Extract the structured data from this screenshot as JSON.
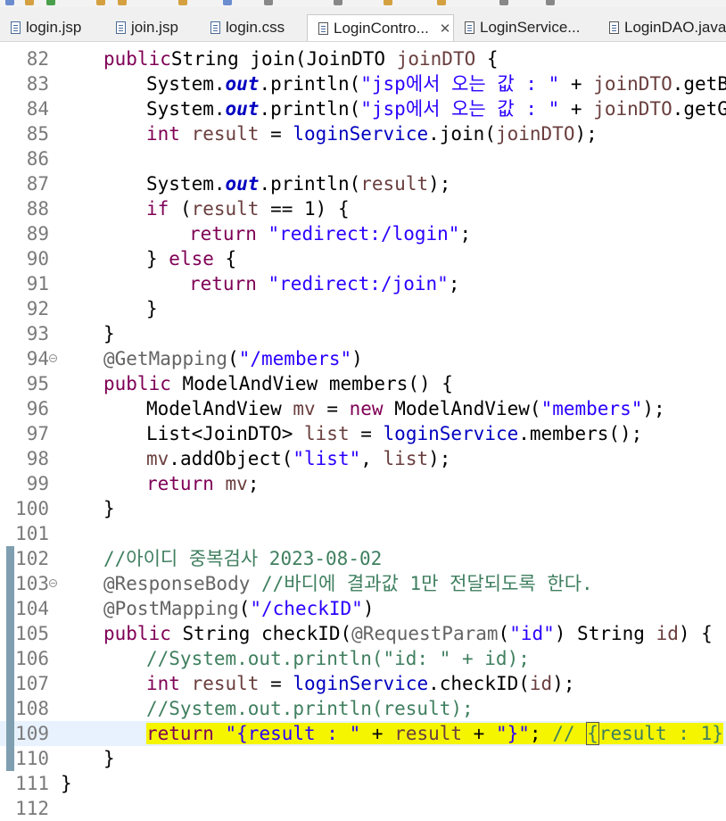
{
  "tabs": [
    {
      "label": "login.jsp",
      "icon": "jsp-file-icon",
      "active": false
    },
    {
      "label": "join.jsp",
      "icon": "jsp-file-icon",
      "active": false
    },
    {
      "label": "login.css",
      "icon": "css-file-icon",
      "active": false
    },
    {
      "label": "LoginContro...",
      "icon": "java-file-icon",
      "active": true,
      "close": "✕"
    },
    {
      "label": "LoginService...",
      "icon": "java-file-icon",
      "active": false
    },
    {
      "label": "LoginDAO.java",
      "icon": "java-file-icon",
      "active": false
    }
  ],
  "editor": {
    "current_line": 109,
    "lines": [
      {
        "n": "82",
        "indent": 1,
        "tokens": [
          [
            "kw",
            "public"
          ],
          [
            "",
            "String join(JoinDTO "
          ],
          [
            "var",
            "joinDTO"
          ],
          [
            "",
            " {"
          ]
        ]
      },
      {
        "n": "83",
        "indent": 2,
        "tokens": [
          [
            "",
            "System."
          ],
          [
            "sfld",
            "out"
          ],
          [
            "",
            ".println("
          ],
          [
            "str",
            "\"jsp에서 오는 값 : \""
          ],
          [
            "",
            " + "
          ],
          [
            "var",
            "joinDTO"
          ],
          [
            "",
            ".getBi"
          ]
        ]
      },
      {
        "n": "84",
        "indent": 2,
        "tokens": [
          [
            "",
            "System."
          ],
          [
            "sfld",
            "out"
          ],
          [
            "",
            ".println("
          ],
          [
            "str",
            "\"jsp에서 오는 값 : \""
          ],
          [
            "",
            " + "
          ],
          [
            "var",
            "joinDTO"
          ],
          [
            "",
            ".getGe"
          ]
        ]
      },
      {
        "n": "85",
        "indent": 2,
        "tokens": [
          [
            "kw",
            "int"
          ],
          [
            "",
            " "
          ],
          [
            "var",
            "result"
          ],
          [
            "",
            " = "
          ],
          [
            "fld",
            "loginService"
          ],
          [
            "",
            ".join("
          ],
          [
            "var",
            "joinDTO"
          ],
          [
            "",
            ");"
          ]
        ]
      },
      {
        "n": "86",
        "indent": 2,
        "tokens": []
      },
      {
        "n": "87",
        "indent": 2,
        "tokens": [
          [
            "",
            "System."
          ],
          [
            "sfld",
            "out"
          ],
          [
            "",
            ".println("
          ],
          [
            "var",
            "result"
          ],
          [
            "",
            ");"
          ]
        ]
      },
      {
        "n": "88",
        "indent": 2,
        "tokens": [
          [
            "kw",
            "if"
          ],
          [
            "",
            " ("
          ],
          [
            "var",
            "result"
          ],
          [
            "",
            " == 1) {"
          ]
        ]
      },
      {
        "n": "89",
        "indent": 3,
        "tokens": [
          [
            "kw",
            "return"
          ],
          [
            "",
            " "
          ],
          [
            "str",
            "\"redirect:/login\""
          ],
          [
            "",
            ";"
          ]
        ]
      },
      {
        "n": "90",
        "indent": 2,
        "tokens": [
          [
            "",
            "} "
          ],
          [
            "kw",
            "else"
          ],
          [
            "",
            " {"
          ]
        ]
      },
      {
        "n": "91",
        "indent": 3,
        "tokens": [
          [
            "kw",
            "return"
          ],
          [
            "",
            " "
          ],
          [
            "str",
            "\"redirect:/join\""
          ],
          [
            "",
            ";"
          ]
        ]
      },
      {
        "n": "92",
        "indent": 2,
        "tokens": [
          [
            "",
            "}"
          ]
        ]
      },
      {
        "n": "93",
        "indent": 1,
        "tokens": [
          [
            "",
            "}"
          ]
        ]
      },
      {
        "n": "94",
        "indent": 1,
        "fold": true,
        "tokens": [
          [
            "ann",
            "@GetMapping"
          ],
          [
            "",
            "("
          ],
          [
            "str",
            "\"/members\""
          ],
          [
            "",
            ")"
          ]
        ]
      },
      {
        "n": "95",
        "indent": 1,
        "tokens": [
          [
            "kw",
            "public"
          ],
          [
            "",
            " ModelAndView members() {"
          ]
        ]
      },
      {
        "n": "96",
        "indent": 2,
        "tokens": [
          [
            "",
            "ModelAndView "
          ],
          [
            "var",
            "mv"
          ],
          [
            "",
            " = "
          ],
          [
            "kw",
            "new"
          ],
          [
            "",
            " ModelAndView("
          ],
          [
            "str",
            "\"members\""
          ],
          [
            "",
            ");"
          ]
        ]
      },
      {
        "n": "97",
        "indent": 2,
        "tokens": [
          [
            "",
            "List<JoinDTO> "
          ],
          [
            "var",
            "list"
          ],
          [
            "",
            " = "
          ],
          [
            "fld",
            "loginService"
          ],
          [
            "",
            ".members();"
          ]
        ]
      },
      {
        "n": "98",
        "indent": 2,
        "tokens": [
          [
            "var",
            "mv"
          ],
          [
            "",
            ".addObject("
          ],
          [
            "str",
            "\"list\""
          ],
          [
            "",
            ", "
          ],
          [
            "var",
            "list"
          ],
          [
            "",
            ");"
          ]
        ]
      },
      {
        "n": "99",
        "indent": 2,
        "tokens": [
          [
            "kw",
            "return"
          ],
          [
            "",
            " "
          ],
          [
            "var",
            "mv"
          ],
          [
            "",
            ";"
          ]
        ]
      },
      {
        "n": "100",
        "indent": 1,
        "tokens": [
          [
            "",
            "}"
          ]
        ]
      },
      {
        "n": "101",
        "indent": 1,
        "tokens": []
      },
      {
        "n": "102",
        "indent": 1,
        "changed": true,
        "tokens": [
          [
            "cmt",
            "//아이디 중복검사 2023-08-02"
          ]
        ]
      },
      {
        "n": "103",
        "indent": 1,
        "changed": true,
        "fold": true,
        "tokens": [
          [
            "ann",
            "@ResponseBody"
          ],
          [
            "",
            " "
          ],
          [
            "cmt",
            "//바디에 결과값 1만 전달되도록 한다."
          ]
        ]
      },
      {
        "n": "104",
        "indent": 1,
        "changed": true,
        "tokens": [
          [
            "ann",
            "@PostMapping"
          ],
          [
            "",
            "("
          ],
          [
            "str",
            "\"/checkID\""
          ],
          [
            "",
            ")"
          ]
        ]
      },
      {
        "n": "105",
        "indent": 1,
        "changed": true,
        "tokens": [
          [
            "kw",
            "public"
          ],
          [
            "",
            " String checkID("
          ],
          [
            "ann",
            "@RequestParam"
          ],
          [
            "",
            "("
          ],
          [
            "str",
            "\"id\""
          ],
          [
            "",
            ") String "
          ],
          [
            "var",
            "id"
          ],
          [
            "",
            ") {"
          ]
        ]
      },
      {
        "n": "106",
        "indent": 2,
        "changed": true,
        "tokens": [
          [
            "cmt",
            "//System.out.println(\"id: \" + id);"
          ]
        ]
      },
      {
        "n": "107",
        "indent": 2,
        "changed": true,
        "tokens": [
          [
            "kw",
            "int"
          ],
          [
            "",
            " "
          ],
          [
            "var",
            "result"
          ],
          [
            "",
            " = "
          ],
          [
            "fld",
            "loginService"
          ],
          [
            "",
            ".checkID("
          ],
          [
            "var",
            "id"
          ],
          [
            "",
            ");"
          ]
        ]
      },
      {
        "n": "108",
        "indent": 2,
        "changed": true,
        "tokens": [
          [
            "cmt",
            "//System.out.println(result);"
          ]
        ]
      },
      {
        "n": "109",
        "indent": 2,
        "changed": true,
        "highlight": true,
        "tokens": [
          [
            "kw",
            "return"
          ],
          [
            "",
            " "
          ],
          [
            "str",
            "\"{result : \""
          ],
          [
            "",
            " + "
          ],
          [
            "var",
            "result"
          ],
          [
            "",
            " + "
          ],
          [
            "str",
            "\"}\""
          ],
          [
            "",
            "; "
          ],
          [
            "cmt",
            "// "
          ],
          [
            "cmt-box",
            "{"
          ],
          [
            "cmt",
            "result : 1}"
          ]
        ]
      },
      {
        "n": "110",
        "indent": 1,
        "changed": true,
        "tokens": [
          [
            "",
            "}"
          ]
        ]
      },
      {
        "n": "111",
        "indent": 0,
        "tokens": [
          [
            "",
            "}"
          ]
        ]
      },
      {
        "n": "112",
        "indent": 0,
        "tokens": []
      }
    ]
  },
  "colors": {
    "keyword": "#7f0055",
    "string": "#2a00ff",
    "comment": "#3f7f5f",
    "annotation": "#646464",
    "local_variable": "#6a3e3e",
    "field": "#0000c0",
    "highlight": "#f5f500",
    "current_line": "#e8f2fe"
  }
}
